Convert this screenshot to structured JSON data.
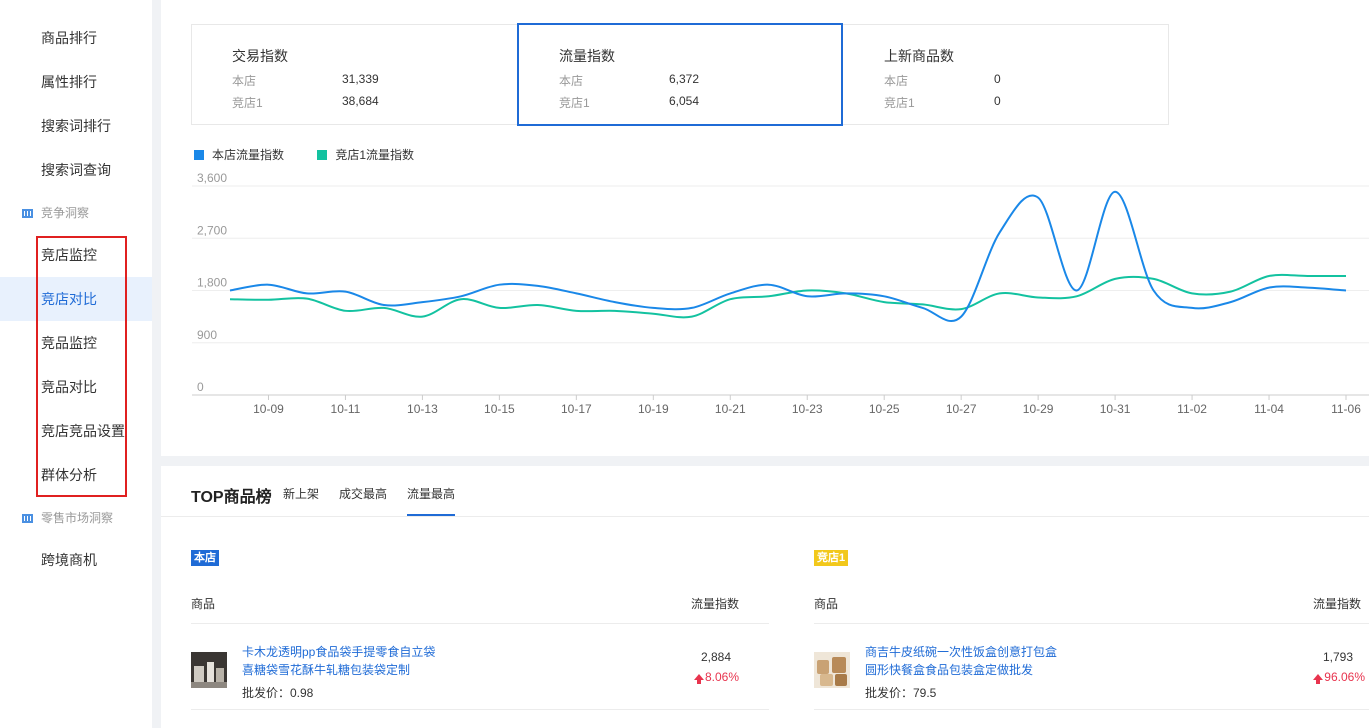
{
  "sidebar": {
    "items": [
      {
        "label": "商品排行",
        "active": false
      },
      {
        "label": "属性排行",
        "active": false
      },
      {
        "label": "搜索词排行",
        "active": false
      },
      {
        "label": "搜索词查询",
        "active": false
      }
    ],
    "group1": "竞争洞察",
    "group1_items": [
      {
        "label": "竞店监控",
        "active": false
      },
      {
        "label": "竞店对比",
        "active": true
      },
      {
        "label": "竞品监控",
        "active": false
      },
      {
        "label": "竞品对比",
        "active": false
      },
      {
        "label": "竞店竞品设置",
        "active": false
      },
      {
        "label": "群体分析",
        "active": false
      }
    ],
    "group2": "零售市场洞察",
    "group2_items": [
      {
        "label": "跨境商机",
        "active": false
      }
    ]
  },
  "metrics": [
    {
      "title": "交易指数",
      "row1_label": "本店",
      "row1_value": "31,339",
      "row2_label": "竞店1",
      "row2_value": "38,684",
      "selected": false
    },
    {
      "title": "流量指数",
      "row1_label": "本店",
      "row1_value": "6,372",
      "row2_label": "竞店1",
      "row2_value": "6,054",
      "selected": true
    },
    {
      "title": "上新商品数",
      "row1_label": "本店",
      "row1_value": "0",
      "row2_label": "竞店1",
      "row2_value": "0",
      "selected": false
    }
  ],
  "colors": {
    "primary": "#1f6bd6",
    "series_self": "#1a88e8",
    "series_rival": "#13c2a0",
    "badge_self": "#1f6bd6",
    "badge_rival": "#f2c81b",
    "up": "#e8344e"
  },
  "chart_data": {
    "type": "line",
    "x": [
      "10-08",
      "10-09",
      "10-10",
      "10-11",
      "10-12",
      "10-13",
      "10-14",
      "10-15",
      "10-16",
      "10-17",
      "10-18",
      "10-19",
      "10-20",
      "10-21",
      "10-22",
      "10-23",
      "10-24",
      "10-25",
      "10-26",
      "10-27",
      "10-28",
      "10-29",
      "10-30",
      "10-31",
      "11-01",
      "11-02",
      "11-03",
      "11-04",
      "11-05",
      "11-06"
    ],
    "x_tick_labels": [
      "10-09",
      "10-11",
      "10-13",
      "10-15",
      "10-17",
      "10-19",
      "10-21",
      "10-23",
      "10-25",
      "10-27",
      "10-29",
      "10-31",
      "11-02",
      "11-04",
      "11-06"
    ],
    "series": [
      {
        "name": "本店流量指数",
        "values": [
          1800,
          1900,
          1750,
          1780,
          1550,
          1600,
          1700,
          1900,
          1880,
          1750,
          1600,
          1500,
          1500,
          1750,
          1900,
          1700,
          1750,
          1700,
          1500,
          1350,
          2800,
          3400,
          1800,
          3500,
          1800,
          1500,
          1600,
          1850,
          1850,
          1800
        ]
      },
      {
        "name": "竞店1流量指数",
        "values": [
          1650,
          1640,
          1660,
          1450,
          1500,
          1350,
          1650,
          1500,
          1550,
          1450,
          1450,
          1400,
          1350,
          1650,
          1700,
          1800,
          1750,
          1600,
          1560,
          1480,
          1750,
          1680,
          1700,
          2000,
          2000,
          1750,
          1780,
          2050,
          2050,
          2050
        ]
      }
    ],
    "y_ticks": [
      "3,600",
      "2,700",
      "1,800",
      "900",
      "0"
    ],
    "ylim": [
      0,
      3600
    ],
    "grid": true,
    "legend": "top-left"
  },
  "top": {
    "title": "TOP商品榜",
    "tabs": [
      {
        "label": "新上架",
        "active": false
      },
      {
        "label": "成交最高",
        "active": false
      },
      {
        "label": "流量最高",
        "active": true
      }
    ],
    "self": {
      "badge": "本店",
      "col_product": "商品",
      "col_flow": "流量指数",
      "product_line1": "卡木龙透明pp食品袋手提零食自立袋",
      "product_line2": "喜糖袋雪花酥牛轧糖包装袋定制",
      "price": "批发价：0.98",
      "flow": "2,884",
      "pct": "8.06%"
    },
    "rival": {
      "badge": "竞店1",
      "col_product": "商品",
      "col_flow": "流量指数",
      "product_line1": "商吉牛皮纸碗一次性饭盒创意打包盒",
      "product_line2": "圆形快餐盒食品包装盒定做批发",
      "price": "批发价：79.5",
      "flow": "1,793",
      "pct": "96.06%"
    }
  }
}
